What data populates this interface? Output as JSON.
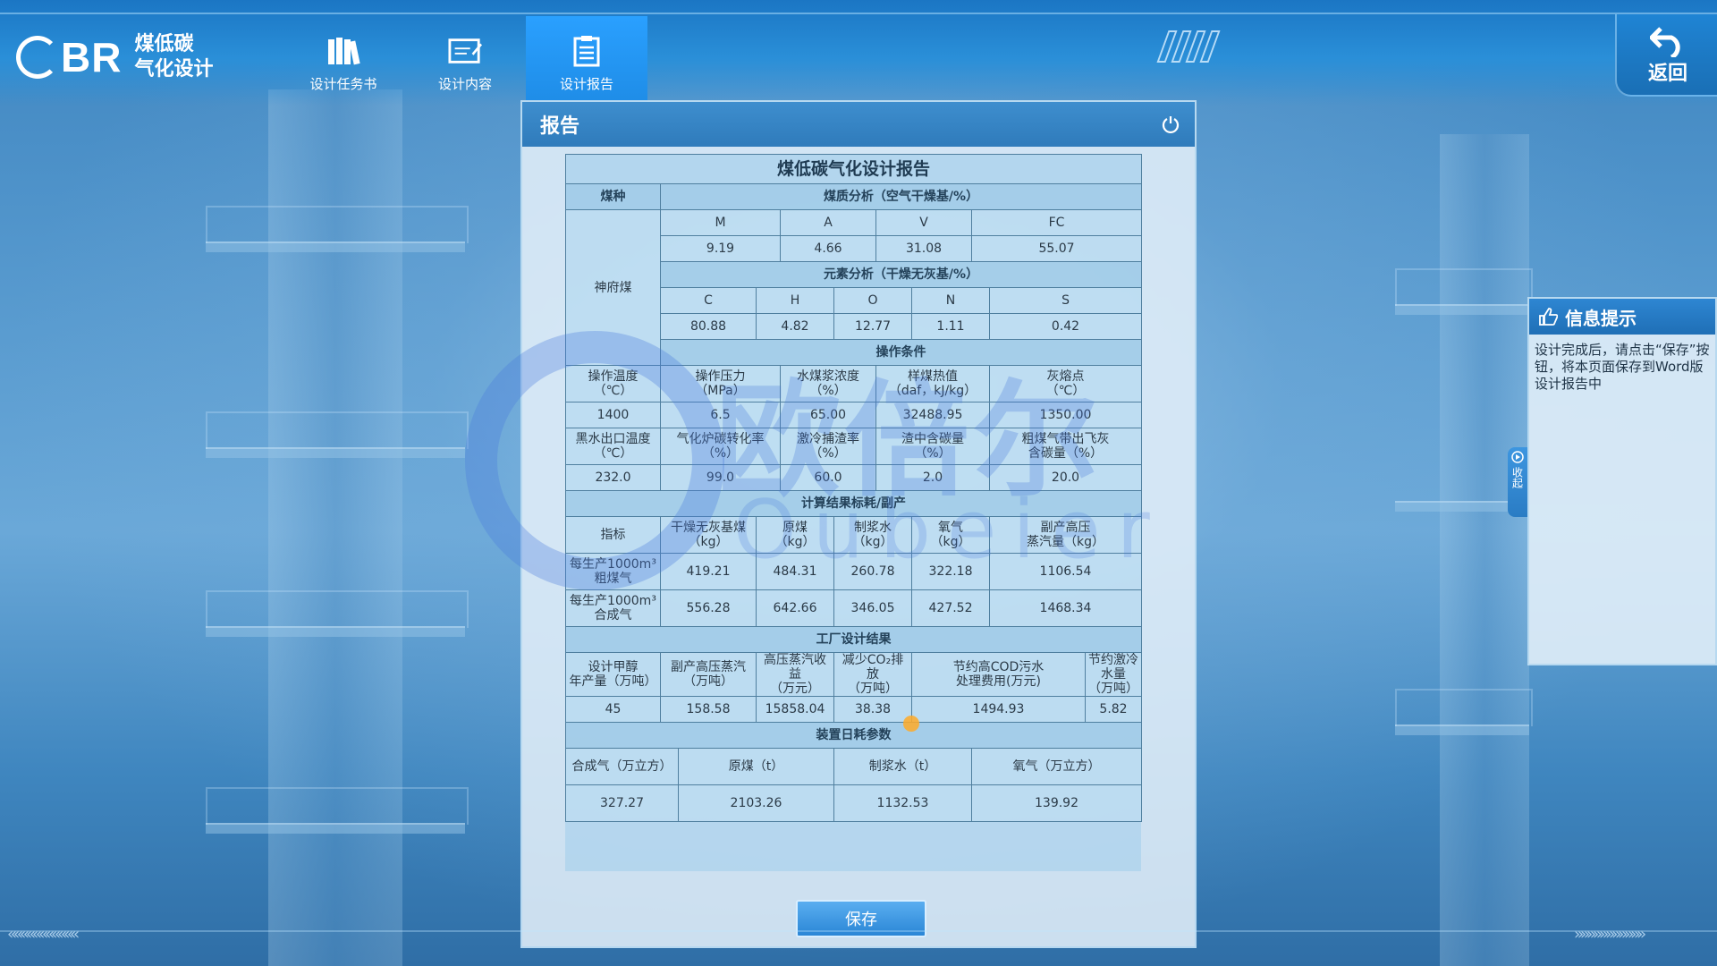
{
  "app": {
    "logo_text": "BR",
    "title_line1": "煤低碳",
    "title_line2": "气化设计"
  },
  "nav": [
    {
      "label": "设计任务书",
      "icon": "books-icon"
    },
    {
      "label": "设计内容",
      "icon": "document-edit-icon"
    },
    {
      "label": "设计报告",
      "icon": "clipboard-icon",
      "active": true
    }
  ],
  "back": {
    "label": "返回"
  },
  "panel": {
    "title": "报告",
    "save_label": "保存"
  },
  "report": {
    "title": "煤低碳气化设计报告",
    "coal_type_header": "煤种",
    "coal_type": "神府煤",
    "proximate_header": "煤质分析（空气干燥基/%）",
    "proximate_cols": [
      "M",
      "A",
      "V",
      "FC"
    ],
    "proximate_vals": [
      "9.19",
      "4.66",
      "31.08",
      "55.07"
    ],
    "ultimate_header": "元素分析（干燥无灰基/%）",
    "ultimate_cols": [
      "C",
      "H",
      "O",
      "N",
      "S"
    ],
    "ultimate_vals": [
      "80.88",
      "4.82",
      "12.77",
      "1.11",
      "0.42"
    ],
    "operating_header": "操作条件",
    "op_row1_labels": [
      [
        "操作温度",
        "（℃）"
      ],
      [
        "操作压力",
        "（MPa）"
      ],
      [
        "水煤浆浓度",
        "（%）"
      ],
      [
        "样煤热值",
        "（daf，kJ/kg）"
      ],
      [
        "灰熔点",
        "（℃）"
      ]
    ],
    "op_row1_vals": [
      "1400",
      "6.5",
      "65.00",
      "32488.95",
      "1350.00"
    ],
    "op_row2_labels": [
      [
        "黑水出口温度",
        "（℃）"
      ],
      [
        "气化炉碳转化率",
        "（%）"
      ],
      [
        "激冷捕渣率",
        "（%）"
      ],
      [
        "渣中含碳量",
        "（%）"
      ],
      [
        "粗煤气带出飞灰",
        "含碳量（%）"
      ]
    ],
    "op_row2_vals": [
      "232.0",
      "99.0",
      "60.0",
      "2.0",
      "20.0"
    ],
    "calc_header": "计算结果标耗/副产",
    "calc_index_label": "指标",
    "calc_cols": [
      [
        "干燥无灰基煤",
        "（kg）"
      ],
      [
        "原煤",
        "（kg）"
      ],
      [
        "制浆水",
        "（kg）"
      ],
      [
        "氧气",
        "（kg）"
      ],
      [
        "副产高压",
        "蒸汽量（kg）"
      ]
    ],
    "calc_rows": [
      {
        "label1": "每生产1000m³",
        "label2": "粗煤气",
        "vals": [
          "419.21",
          "484.31",
          "260.78",
          "322.18",
          "1106.54"
        ]
      },
      {
        "label1": "每生产1000m³",
        "label2": "合成气",
        "vals": [
          "556.28",
          "642.66",
          "346.05",
          "427.52",
          "1468.34"
        ]
      }
    ],
    "plant_header": "工厂设计结果",
    "plant_cols": [
      [
        "设计甲醇",
        "年产量（万吨）"
      ],
      [
        "副产高压蒸汽",
        "（万吨）"
      ],
      [
        "高压蒸汽收益",
        "（万元）"
      ],
      [
        "减少CO₂排放",
        "（万吨）"
      ],
      [
        "节约高COD污水",
        "处理费用(万元)"
      ],
      [
        "节约激冷水量",
        "（万吨）"
      ]
    ],
    "plant_vals": [
      "45",
      "158.58",
      "15858.04",
      "38.38",
      "1494.93",
      "5.82"
    ],
    "daily_header": "装置日耗参数",
    "daily_cols": [
      "合成气（万立方）",
      "原煤（t）",
      "制浆水（t）",
      "氧气（万立方）"
    ],
    "daily_vals": [
      "327.27",
      "2103.26",
      "1132.53",
      "139.92"
    ]
  },
  "watermark": {
    "cn": "欧倍尔",
    "en": "Oubeier"
  },
  "info": {
    "title": "信息提示",
    "text": "设计完成后，请点击“保存”按钮，将本页面保存到Word版设计报告中",
    "collapse_label": "收起"
  },
  "colors": {
    "accent": "#2a8fd8",
    "panel_head": "#3e8ece"
  }
}
